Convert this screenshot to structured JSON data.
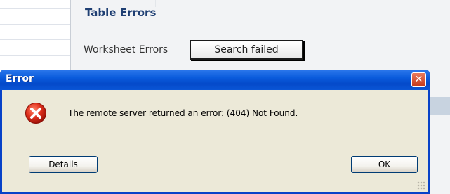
{
  "background": {
    "section_title": "Table Errors",
    "worksheet_label": "Worksheet Errors",
    "search_button": "Search failed"
  },
  "dialog": {
    "title": "Error",
    "close_glyph": "✕",
    "icon": "error-icon",
    "message": "The remote server returned an error: (404) Not Found.",
    "details_label": "Details",
    "ok_label": "OK"
  },
  "colors": {
    "titlebar": "#0a5bdc",
    "dialog_body": "#ece9d8",
    "close_button": "#c4381a",
    "error_icon": "#d42a1c"
  }
}
